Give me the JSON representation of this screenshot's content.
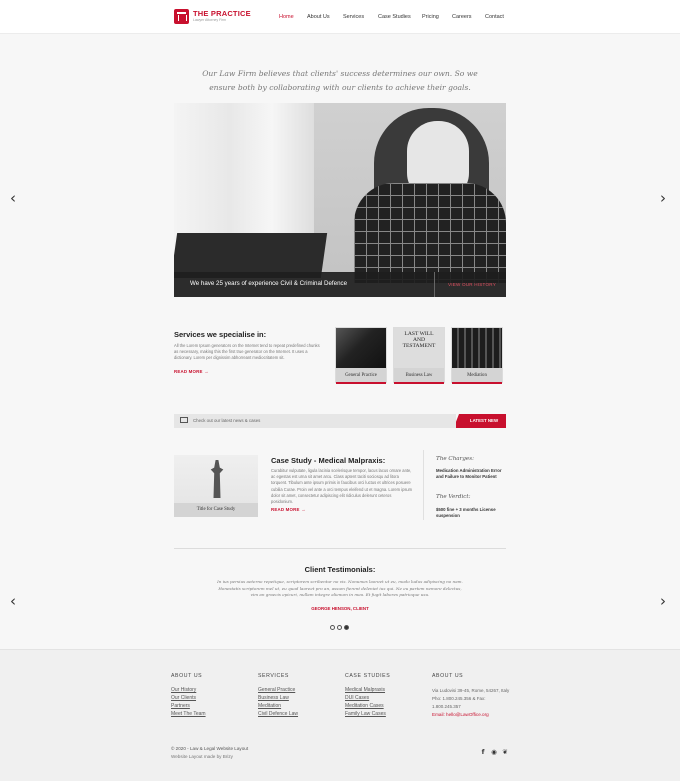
{
  "header": {
    "brand": "THE PRACTICE",
    "tagline": "Lawyer Attorney Firm",
    "nav": [
      "Home",
      "About Us",
      "Services",
      "Case Studies",
      "Pricing",
      "Careers",
      "Contact"
    ],
    "active_nav": "Home"
  },
  "intro": {
    "quote": "Our Law Firm believes that clients' success determines our own. So we ensure both by collaborating with our clients to achieve their goals."
  },
  "hero": {
    "caption": "We have 25 years of experience Civil & Criminal Defence",
    "link": "VIEW OUR HISTORY",
    "prev_icon": "chevron-left-icon",
    "next_icon": "chevron-right-icon"
  },
  "services": {
    "title": "Services we specialise in:",
    "description": "All the Lorem Ipsum generators on the Internet tend to repeat predefined chunks as necessary, making this the first true generator on the Internet. It uses a dictionary. Lorem per dignissim abhorreant mediocritatem sit.",
    "read_more": "READ MORE",
    "tiles": [
      "General Practice",
      "Business Law",
      "Mediation"
    ]
  },
  "news": {
    "text": "Check out our latest news & cases",
    "button": "LATEST NEW"
  },
  "case_study": {
    "image_caption": "Title for Case Study",
    "title": "Case Study - Medical Malpraxis:",
    "description": "Curabitur vulputate, ligula lacinia scelerisque tempor, lacus lacus ornare ante, ac egestas est urna sit amet arcu. Class aptent taciti sociosqu ad litora torquent. Tibulum ante ipsum primis in faucibus orci luctus et ultrices posuere cubilia Curae. Proin vel ante a orci tempus eleifend ut et magna. Lorem ipsum dolor sit amet, consectetur adipiscing elit ridiculus delerunt ceteros posidonium.",
    "read_more": "READ MORE",
    "charges_heading": "The Charges:",
    "charges": "Medication Administration Error and Failure to Monitor Patient",
    "verdict_heading": "The Verdict:",
    "verdict": "$500 fine + 3 months License suspension"
  },
  "testimonials": {
    "title": "Client Testimonials:",
    "text": "In ius persius aeterno repetique, scriptorem scribentur no vis. Nonumes laoreet ut eu, modo ludus adipiscing no nam. Honestatis scriptorem mel ut, eu quod laoreet pro an, assum fierent deleniet ius qui. Ne eu partem nemore delectus, vim an graecis epicuri, nullam integre alienum in mea. Et fugit labores patrioque usu.",
    "author": "GEORGE HENSON, CLIENT",
    "dots": 3,
    "active_dot": 3
  },
  "footer": {
    "columns": [
      {
        "heading": "ABOUT US",
        "links": [
          "Our History",
          "Our Clients",
          "Partners",
          "Meet The Team"
        ]
      },
      {
        "heading": "SERVICES",
        "links": [
          "General Practice",
          "Business Law",
          "Meditation",
          "Civil Defence Law"
        ]
      },
      {
        "heading": "CASE STUDIES",
        "links": [
          "Medical Malpraxis",
          "DUI Cases",
          "Meditation Cases",
          "Family Law Cases"
        ]
      }
    ],
    "about_heading": "ABOUT US",
    "address": "Via Ludovisi 39-45, Rome, 54267, Italy Pho: 1.800.245.356 & Fax: 1.800.245.357",
    "email": "Email: hello@LawOffice.org",
    "copyright": "© 2020 - Law & Legal Website Layout",
    "made_by": "Website Layout made by Brizy",
    "social_icons": [
      "facebook-icon",
      "pinterest-icon",
      "twitter-icon"
    ]
  }
}
